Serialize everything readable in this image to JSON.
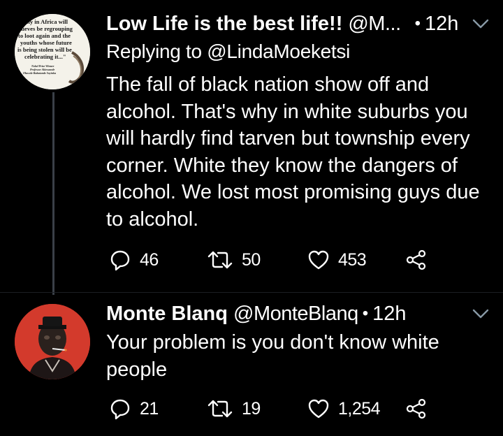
{
  "tweets": [
    {
      "name": "Low Life is the best life!!",
      "handle": "@M...",
      "time": "12h",
      "reply_to": "Replying to @LindaMoeketsi",
      "text": "The fall of black nation show off and alcohol. That's why in white suburbs you will hardly find tarven but township every corner. White they know the dangers of alcohol. We lost most promising guys due to alcohol.",
      "avatar_text": {
        "lines": [
          "Only in Africa will",
          "thieves be regrouping",
          "to loot again and the",
          "youths whose future",
          "is being stolen will be",
          "celebrating it...\""
        ],
        "credit": [
          "Nobel Prize Winner",
          "Professor Akinwande",
          "Oluwole Babatunde Soyinka"
        ]
      },
      "replies": "46",
      "retweets": "50",
      "likes": "453"
    },
    {
      "name": "Monte Blanq",
      "handle": "@MonteBlanq",
      "time": "12h",
      "text": "Your problem is you don't know white people",
      "replies": "21",
      "retweets": "19",
      "likes": "1,254"
    }
  ],
  "icons": {
    "reply": "reply-icon",
    "retweet": "retweet-icon",
    "like": "heart-icon",
    "share": "share-icon",
    "menu": "chevron-down-icon"
  },
  "colors": {
    "background": "#000000",
    "text": "#ffffff",
    "icon": "#ffffff",
    "thread_line": "#3a4048",
    "avatar2_bg": "#d33a2c"
  }
}
